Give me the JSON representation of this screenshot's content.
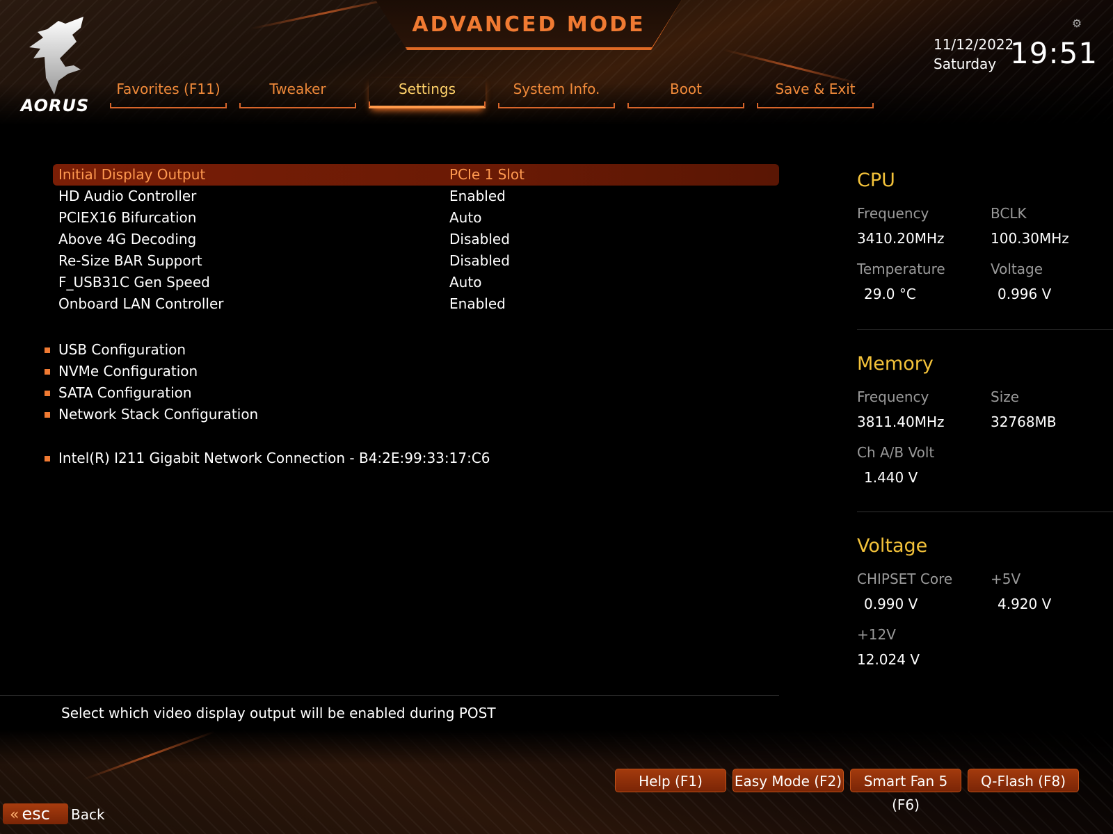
{
  "header": {
    "mode_title": "ADVANCED MODE",
    "logo_text": "AORUS",
    "date": "11/12/2022",
    "day": "Saturday",
    "time": "19:51"
  },
  "tabs": [
    {
      "label": "Favorites (F11)",
      "active": false
    },
    {
      "label": "Tweaker",
      "active": false
    },
    {
      "label": "Settings",
      "active": true
    },
    {
      "label": "System Info.",
      "active": false
    },
    {
      "label": "Boot",
      "active": false
    },
    {
      "label": "Save & Exit",
      "active": false
    }
  ],
  "settings": [
    {
      "name": "Initial Display Output",
      "value": "PCIe 1 Slot",
      "selected": true
    },
    {
      "name": "HD Audio Controller",
      "value": "Enabled"
    },
    {
      "name": "PCIEX16 Bifurcation",
      "value": "Auto"
    },
    {
      "name": "Above 4G Decoding",
      "value": "Disabled"
    },
    {
      "name": "Re-Size BAR Support",
      "value": "Disabled"
    },
    {
      "name": "F_USB31C Gen Speed",
      "value": "Auto"
    },
    {
      "name": "Onboard LAN Controller",
      "value": "Enabled"
    }
  ],
  "submenus": [
    "USB Configuration",
    "NVMe Configuration",
    "SATA Configuration",
    "Network Stack Configuration"
  ],
  "network_device": "Intel(R) I211 Gigabit  Network Connection - B4:2E:99:33:17:C6",
  "cpu": {
    "title": "CPU",
    "frequency_label": "Frequency",
    "frequency": "3410.20MHz",
    "bclk_label": "BCLK",
    "bclk": "100.30MHz",
    "temperature_label": "Temperature",
    "temperature": "29.0 °C",
    "voltage_label": "Voltage",
    "voltage": "0.996 V"
  },
  "memory": {
    "title": "Memory",
    "frequency_label": "Frequency",
    "frequency": "3811.40MHz",
    "size_label": "Size",
    "size": "32768MB",
    "volt_label": "Ch A/B Volt",
    "volt": "1.440 V"
  },
  "voltage": {
    "title": "Voltage",
    "chipset_label": "CHIPSET Core",
    "chipset": "0.990 V",
    "v5_label": "+5V",
    "v5": "4.920 V",
    "v12_label": "+12V",
    "v12": "12.024 V"
  },
  "help_text": "Select which video display output will be enabled during POST",
  "footer": {
    "help": "Help (F1)",
    "easy_mode": "Easy Mode (F2)",
    "smart_fan": "Smart Fan 5 (F6)",
    "qflash": "Q-Flash (F8)",
    "esc": "esc",
    "back": "Back"
  },
  "colors": {
    "accent": "#f07a32",
    "highlight_bg": "#7a1e06",
    "panel_title": "#f3c23a"
  }
}
